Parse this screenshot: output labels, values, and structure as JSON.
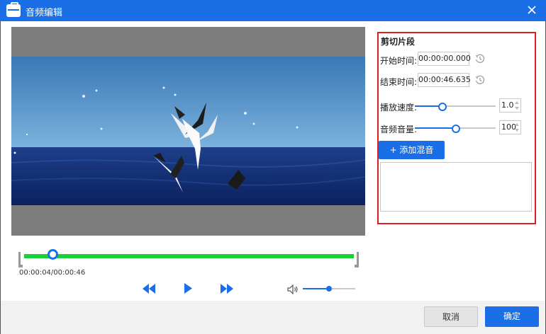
{
  "window": {
    "title": "音频编辑"
  },
  "player": {
    "current_time": "00:00:04",
    "total_time": "00:00:46",
    "time_readout": "00:00:04/00:00:46",
    "progress_fraction": 0.087,
    "volume_fraction": 0.5
  },
  "clip_panel": {
    "title": "剪切片段",
    "start_label": "开始时间:",
    "start_value": "00:00:00.000",
    "end_label": "结束时间:",
    "end_value": "00:00:46.635",
    "speed_label": "播放速度:",
    "speed_value": "1.0",
    "speed_fraction": 0.33,
    "volume_label": "音频音量:",
    "volume_value": "100",
    "volume_fraction": 0.5,
    "add_mix_label": "+ 添加混音"
  },
  "footer": {
    "cancel_label": "取消",
    "ok_label": "确定"
  },
  "colors": {
    "accent": "#1a6fe6",
    "timeline": "#19d03a",
    "highlight_border": "#e01e1e"
  },
  "icons": [
    "app-icon",
    "close-icon",
    "clock-icon",
    "rewind-icon",
    "play-icon",
    "fast-forward-icon",
    "volume-icon",
    "spinner-arrows-icon"
  ]
}
